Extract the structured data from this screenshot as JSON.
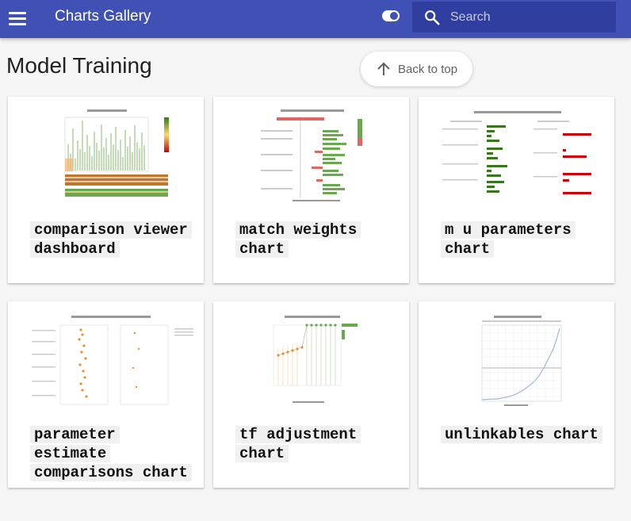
{
  "header": {
    "site_title": "Charts Gallery",
    "search_placeholder": "Search",
    "colors": {
      "primary": "#3f51b5",
      "search_bg": "#303f9f"
    }
  },
  "page": {
    "title": "Model Training",
    "back_to_top_label": "Back to top"
  },
  "cards": [
    {
      "label": "comparison viewer dashboard",
      "thumbnail": "comparison-viewer-dashboard-thumbnail"
    },
    {
      "label": "match weights chart",
      "thumbnail": "match-weights-chart-thumbnail"
    },
    {
      "label": "m u parameters chart",
      "thumbnail": "m-u-parameters-chart-thumbnail"
    },
    {
      "label": "parameter estimate comparisons chart",
      "thumbnail": "parameter-estimate-comparisons-chart-thumbnail"
    },
    {
      "label": "tf adjustment chart",
      "thumbnail": "tf-adjustment-chart-thumbnail"
    },
    {
      "label": "unlinkables chart",
      "thumbnail": "unlinkables-chart-thumbnail"
    }
  ]
}
